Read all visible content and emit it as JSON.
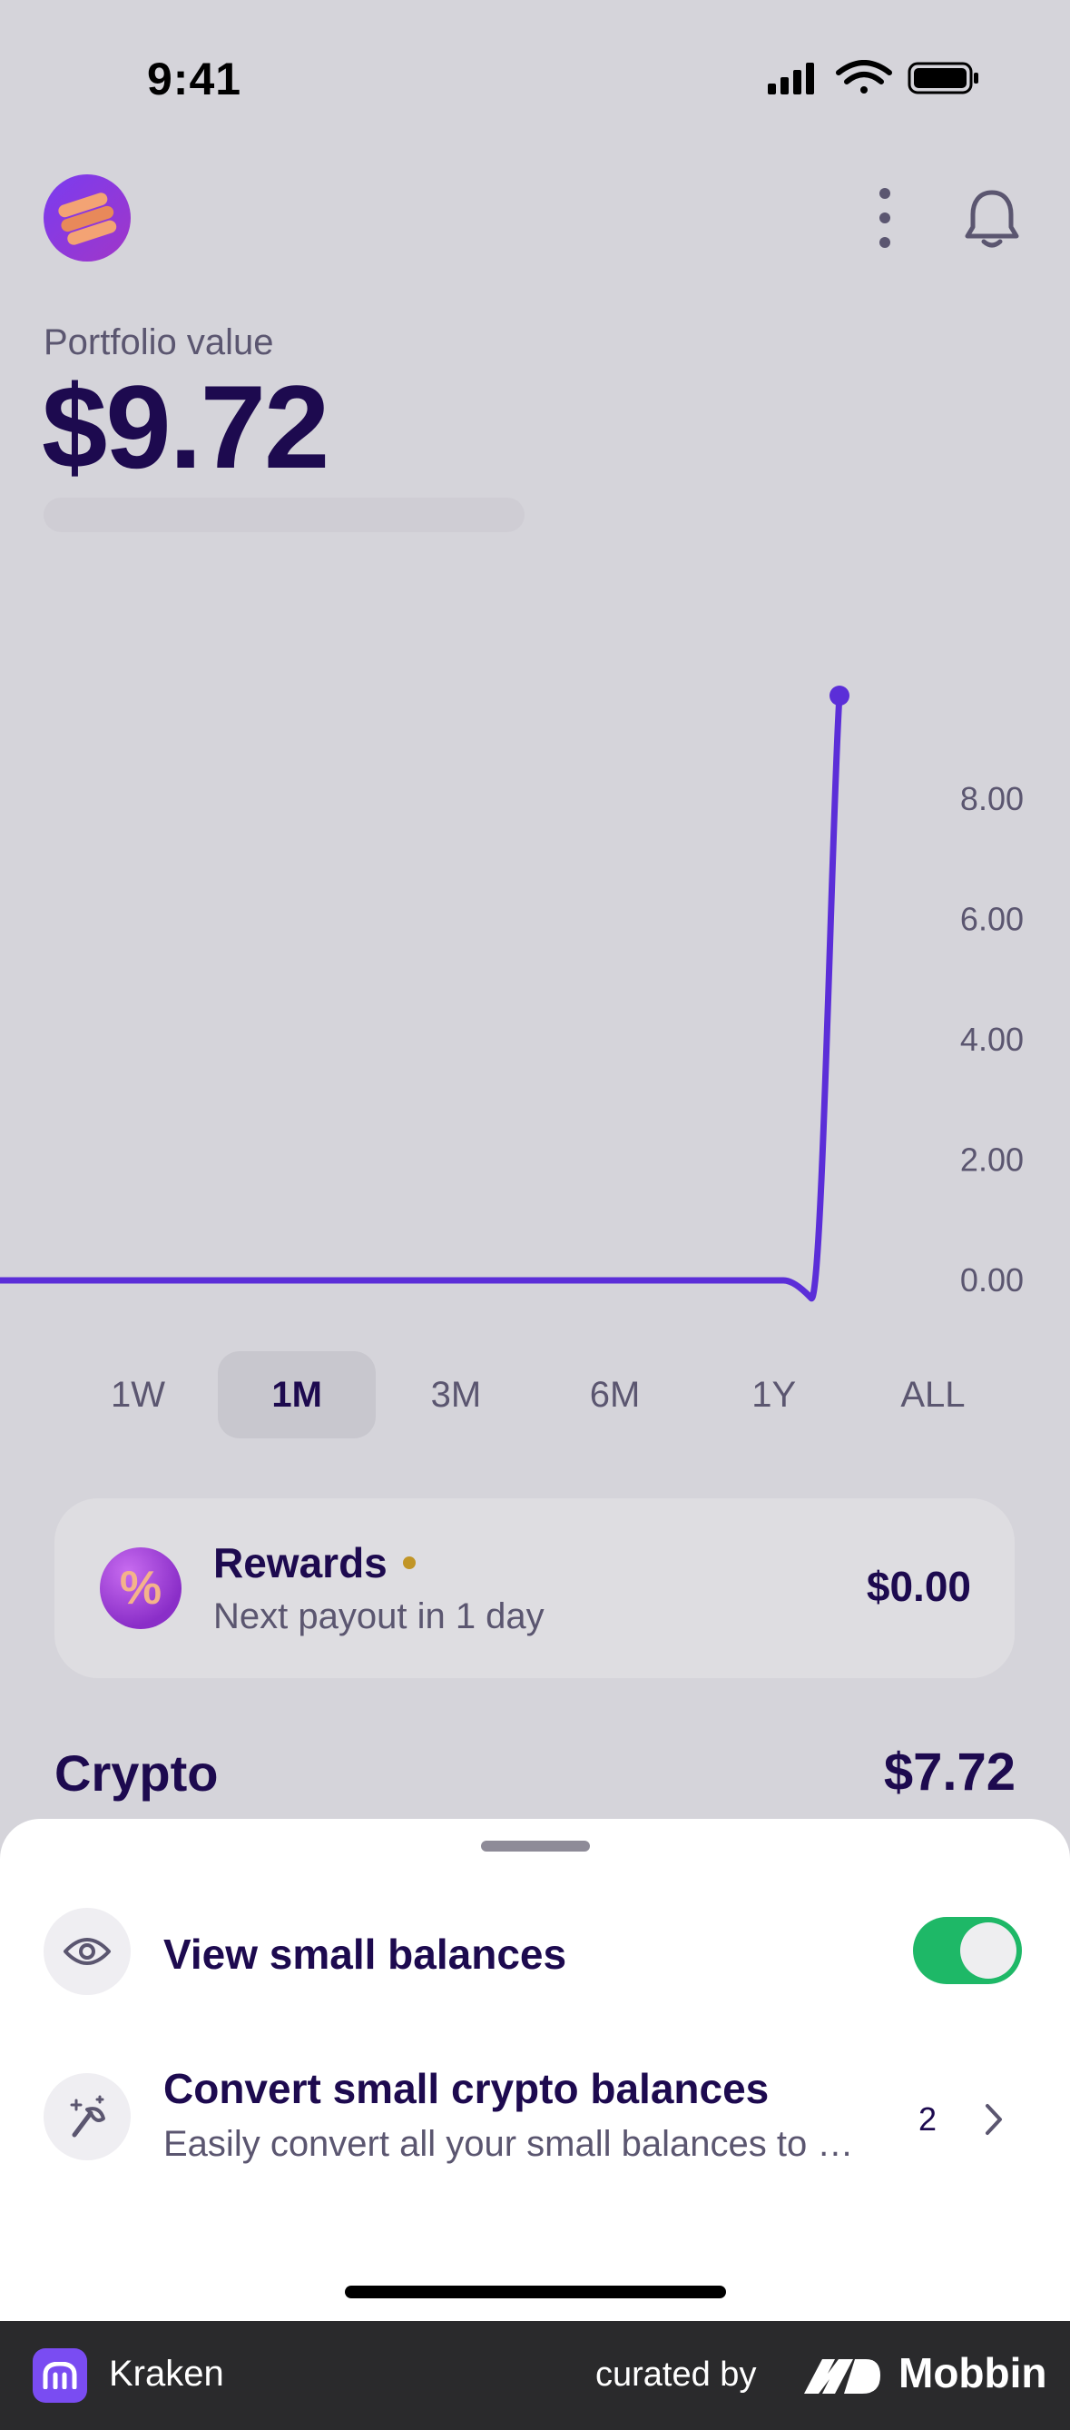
{
  "status_bar": {
    "time": "9:41"
  },
  "portfolio": {
    "label": "Portfolio value",
    "value": "$9.72"
  },
  "chart_data": {
    "type": "line",
    "x": [
      0,
      1,
      2,
      3,
      4,
      5,
      6,
      7,
      8,
      9,
      10,
      11,
      12,
      13,
      14,
      15,
      16,
      17,
      18,
      19,
      20,
      21,
      22,
      23,
      24,
      25,
      26,
      27,
      28,
      29,
      30
    ],
    "series": [
      {
        "values": [
          0,
          0,
          0,
          0,
          0,
          0,
          0,
          0,
          0,
          0,
          0,
          0,
          0,
          0,
          0,
          0,
          0,
          0,
          0,
          0,
          0,
          0,
          0,
          0,
          0,
          0,
          0,
          0,
          0,
          -0.3,
          9.72
        ]
      }
    ],
    "y_ticks": [
      "0.00",
      "2.00",
      "4.00",
      "6.00",
      "8.00"
    ],
    "ylim": [
      0,
      10
    ],
    "grid": false,
    "line_color": "#5b2ed8"
  },
  "timeframes": [
    {
      "label": "1W",
      "active": false
    },
    {
      "label": "1M",
      "active": true
    },
    {
      "label": "3M",
      "active": false
    },
    {
      "label": "6M",
      "active": false
    },
    {
      "label": "1Y",
      "active": false
    },
    {
      "label": "ALL",
      "active": false
    }
  ],
  "rewards": {
    "title": "Rewards",
    "subtitle": "Next payout in 1 day",
    "amount": "$0.00",
    "icon": "percent-icon"
  },
  "crypto": {
    "title": "Crypto",
    "value": "$7.72"
  },
  "sheet": {
    "view_small_balances": {
      "label": "View small balances",
      "enabled": true,
      "icon": "eye-icon"
    },
    "convert_small": {
      "title": "Convert small crypto balances",
      "subtitle": "Easily convert all your small balances to one asset",
      "count": "2",
      "icon": "magic-wand-icon"
    }
  },
  "footer": {
    "app_name": "Kraken",
    "curated_by": "curated by",
    "brand": "Mobbin"
  },
  "colors": {
    "accent": "#5b2ed8",
    "toggle_on": "#1eb867",
    "text_primary": "#1d0a4f",
    "text_secondary": "#5b5670"
  }
}
